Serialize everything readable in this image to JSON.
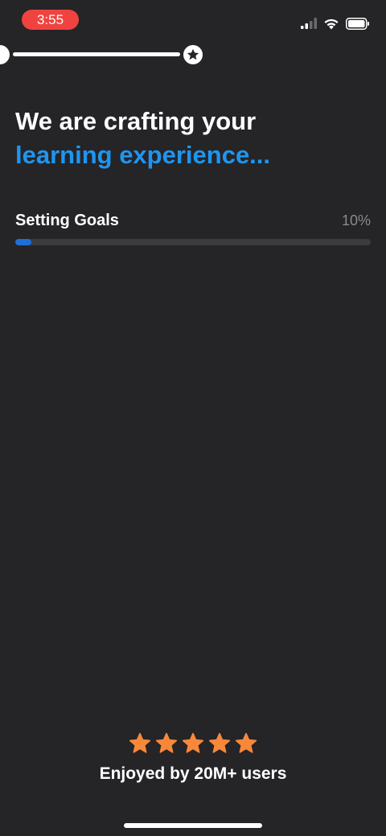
{
  "status_bar": {
    "time": "3:55",
    "time_pill_color": "#f0433f",
    "icons": [
      "cellular-signal-icon",
      "wifi-icon",
      "battery-icon"
    ]
  },
  "progress_track": {
    "end_icon": "star-icon"
  },
  "headline": {
    "line1": "We are crafting your",
    "line2": "learning experience...",
    "accent_color": "#1e96f0"
  },
  "task": {
    "label": "Setting Goals",
    "percent_text": "10%",
    "progress_fraction": 0.045,
    "bar_color": "#1e6fd9"
  },
  "rating": {
    "star_count": 5,
    "star_color": "#f7883a",
    "text": "Enjoyed by 20M+ users"
  },
  "theme": {
    "background": "#252427"
  }
}
